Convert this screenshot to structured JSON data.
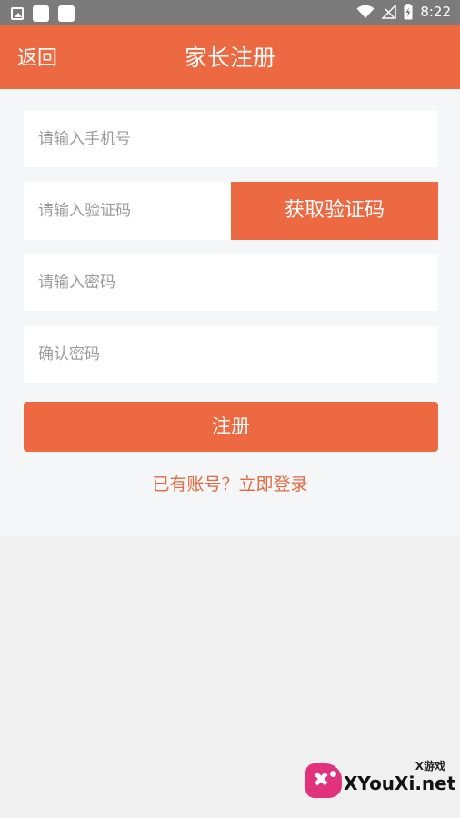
{
  "status_bar": {
    "time": "8:22",
    "left_icons": [
      "image-icon",
      "notification-square-icon",
      "notification-square-icon"
    ],
    "right_icons": [
      "wifi-icon",
      "signal-icon",
      "battery-icon"
    ]
  },
  "header": {
    "back_label": "返回",
    "title": "家长注册"
  },
  "form": {
    "phone_placeholder": "请输入手机号",
    "code_placeholder": "请输入验证码",
    "get_code_label": "获取验证码",
    "password_placeholder": "请输入密码",
    "confirm_placeholder": "确认密码",
    "submit_label": "注册",
    "login_link": "已有账号？立即登录"
  },
  "watermark": {
    "top_text": "X游戏",
    "main_text": "XYouXi.net"
  },
  "colors": {
    "accent": "#ec6941",
    "status_bar": "#7b7b7b",
    "page_bg": "#f0f0f0",
    "panel_bg": "#f5f6f8",
    "link": "#e36a40"
  }
}
